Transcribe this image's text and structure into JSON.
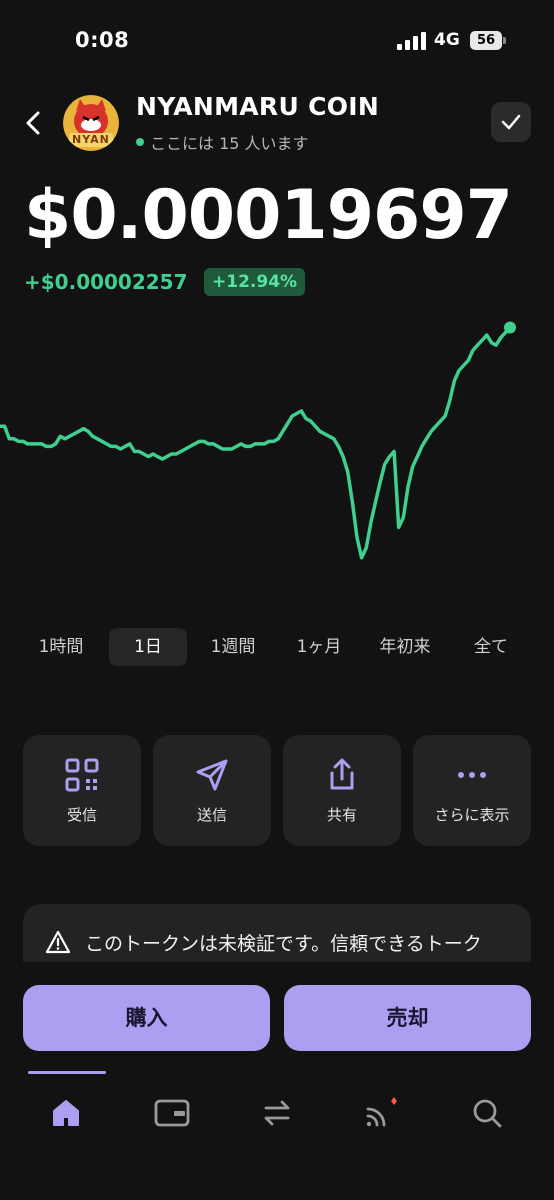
{
  "status_bar": {
    "time": "0:08",
    "network": "4G",
    "battery": "56"
  },
  "header": {
    "coin_name": "NYANMARU COIN",
    "online_text": "ここには 15 人います",
    "avatar_label": "NYAN"
  },
  "price": {
    "value": "$0.00019697",
    "change_abs": "+$0.00002257",
    "change_pct": "+12.94%"
  },
  "colors": {
    "accent": "#ab9ff2",
    "positive": "#3fcf8e",
    "background": "#121212",
    "tile": "#232323"
  },
  "chart_data": {
    "type": "line",
    "series": [
      {
        "values": [
          60,
          60,
          55,
          55,
          54,
          54,
          53,
          53,
          53,
          53,
          52,
          52,
          53,
          56,
          55,
          56,
          57,
          58,
          59,
          58,
          56,
          55,
          54,
          53,
          52,
          52,
          51,
          52,
          53,
          50,
          50,
          49,
          48,
          49,
          48,
          47,
          48,
          49,
          49,
          50,
          51,
          52,
          53,
          54,
          54,
          53,
          53,
          52,
          51,
          51,
          51,
          52,
          53,
          52,
          52,
          53,
          53,
          53,
          54,
          54,
          55,
          58,
          61,
          64,
          65,
          66,
          63,
          62,
          60,
          58,
          57,
          56,
          55,
          52,
          48,
          42,
          30,
          16,
          8,
          12,
          22,
          30,
          38,
          45,
          48,
          50,
          20,
          24,
          36,
          44,
          48,
          52,
          55,
          58,
          60,
          62,
          64,
          70,
          78,
          82,
          84,
          86,
          90,
          92,
          94,
          96,
          93,
          92,
          95,
          97,
          99
        ]
      }
    ]
  },
  "range_tabs": [
    "1時間",
    "1日",
    "1週間",
    "1ヶ月",
    "年初来",
    "全て"
  ],
  "actions": {
    "receive": "受信",
    "send": "送信",
    "share": "共有",
    "more": "さらに表示"
  },
  "warning": {
    "text": "このトークンは未検証です。信頼できるトーク"
  },
  "buttons": {
    "buy": "購入",
    "sell": "売却"
  },
  "nav": [
    "home-icon",
    "wallet-icon",
    "swap-icon",
    "activity-icon",
    "search-icon"
  ]
}
